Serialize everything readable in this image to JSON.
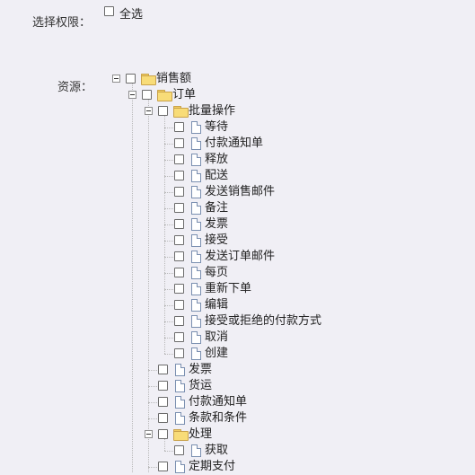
{
  "permissions": {
    "label": "选择权限：",
    "select_all_label": "全选"
  },
  "resources": {
    "label": "资源：",
    "tree": [
      {
        "label": "销售额",
        "type": "folder",
        "depth": 0,
        "expanded": true
      },
      {
        "label": "订单",
        "type": "folder",
        "depth": 1,
        "expanded": true
      },
      {
        "label": "批量操作",
        "type": "folder",
        "depth": 2,
        "expanded": true
      },
      {
        "label": "等待",
        "type": "page",
        "depth": 3
      },
      {
        "label": "付款通知单",
        "type": "page",
        "depth": 3
      },
      {
        "label": "释放",
        "type": "page",
        "depth": 3
      },
      {
        "label": "配送",
        "type": "page",
        "depth": 3
      },
      {
        "label": "发送销售邮件",
        "type": "page",
        "depth": 3
      },
      {
        "label": "备注",
        "type": "page",
        "depth": 3
      },
      {
        "label": "发票",
        "type": "page",
        "depth": 3
      },
      {
        "label": "接受",
        "type": "page",
        "depth": 3
      },
      {
        "label": "发送订单邮件",
        "type": "page",
        "depth": 3
      },
      {
        "label": "每页",
        "type": "page",
        "depth": 3
      },
      {
        "label": "重新下单",
        "type": "page",
        "depth": 3
      },
      {
        "label": "编辑",
        "type": "page",
        "depth": 3
      },
      {
        "label": "接受或拒绝的付款方式",
        "type": "page",
        "depth": 3
      },
      {
        "label": "取消",
        "type": "page",
        "depth": 3
      },
      {
        "label": "创建",
        "type": "page",
        "depth": 3
      },
      {
        "label": "发票",
        "type": "page",
        "depth": 2
      },
      {
        "label": "货运",
        "type": "page",
        "depth": 2
      },
      {
        "label": "付款通知单",
        "type": "page",
        "depth": 2
      },
      {
        "label": "条款和条件",
        "type": "page",
        "depth": 2
      },
      {
        "label": "处理",
        "type": "folder",
        "depth": 2,
        "expanded": true
      },
      {
        "label": "获取",
        "type": "page",
        "depth": 3
      },
      {
        "label": "定期支付",
        "type": "page",
        "depth": 2
      }
    ]
  }
}
